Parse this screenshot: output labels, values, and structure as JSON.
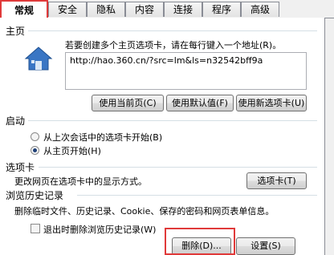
{
  "tabs": [
    "常规",
    "安全",
    "隐私",
    "内容",
    "连接",
    "程序",
    "高级"
  ],
  "home": {
    "group_label": "主页",
    "hint": "若要创建多个主页选项卡，请在每行键入一个地址(R)。",
    "url": "http://hao.360.cn/?src=lm&ls=n32542bff9a",
    "use_current_button": "使用当前页(C)",
    "use_default_button": "使用默认值(F)",
    "use_new_tab_button": "使用新选项卡(U)"
  },
  "startup": {
    "group_label": "启动",
    "option_last_session": "从上次会话中的选项卡开始(B)",
    "option_home": "从主页开始(H)",
    "selected": "option_home"
  },
  "tabs_section": {
    "group_label": "选项卡",
    "description": "更改网页在选项卡中的显示方式。",
    "tabs_button": "选项卡(T)"
  },
  "history": {
    "group_label": "浏览历史记录",
    "description": "删除临时文件、历史记录、Cookie、保存的密码和网页表单信息。",
    "delete_on_exit_label": "退出时删除浏览历史记录(W)",
    "delete_on_exit_checked": false,
    "delete_button": "删除(D)...",
    "settings_button": "设置(S)"
  },
  "colors": {
    "highlight": "#e03a3a",
    "accent": "#1e3f77"
  }
}
